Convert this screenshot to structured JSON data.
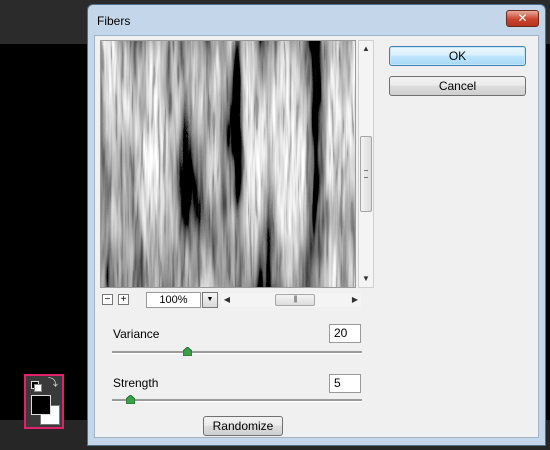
{
  "dialog": {
    "title": "Fibers",
    "close_label": "✕"
  },
  "buttons": {
    "ok_label": "OK",
    "cancel_label": "Cancel",
    "randomize_label": "Randomize"
  },
  "preview": {
    "zoom_value": "100%",
    "zoom_out_label": "−",
    "zoom_in_label": "+"
  },
  "controls": {
    "variance": {
      "label": "Variance",
      "value": "20",
      "slider_fraction": 0.3
    },
    "strength": {
      "label": "Strength",
      "value": "5",
      "slider_fraction": 0.07
    }
  },
  "colors": {
    "dialog_frame": "#c4d7ea",
    "close_button": "#c9452f",
    "panel_highlight": "#e0226a",
    "slider_handle": "#3aa04a"
  },
  "icons": [
    "close-icon",
    "zoom-out-icon",
    "zoom-in-icon",
    "dropdown-arrow-icon",
    "scroll-up-icon",
    "scroll-down-icon",
    "scroll-left-icon",
    "scroll-right-icon",
    "default-colors-icon",
    "swap-colors-icon"
  ]
}
